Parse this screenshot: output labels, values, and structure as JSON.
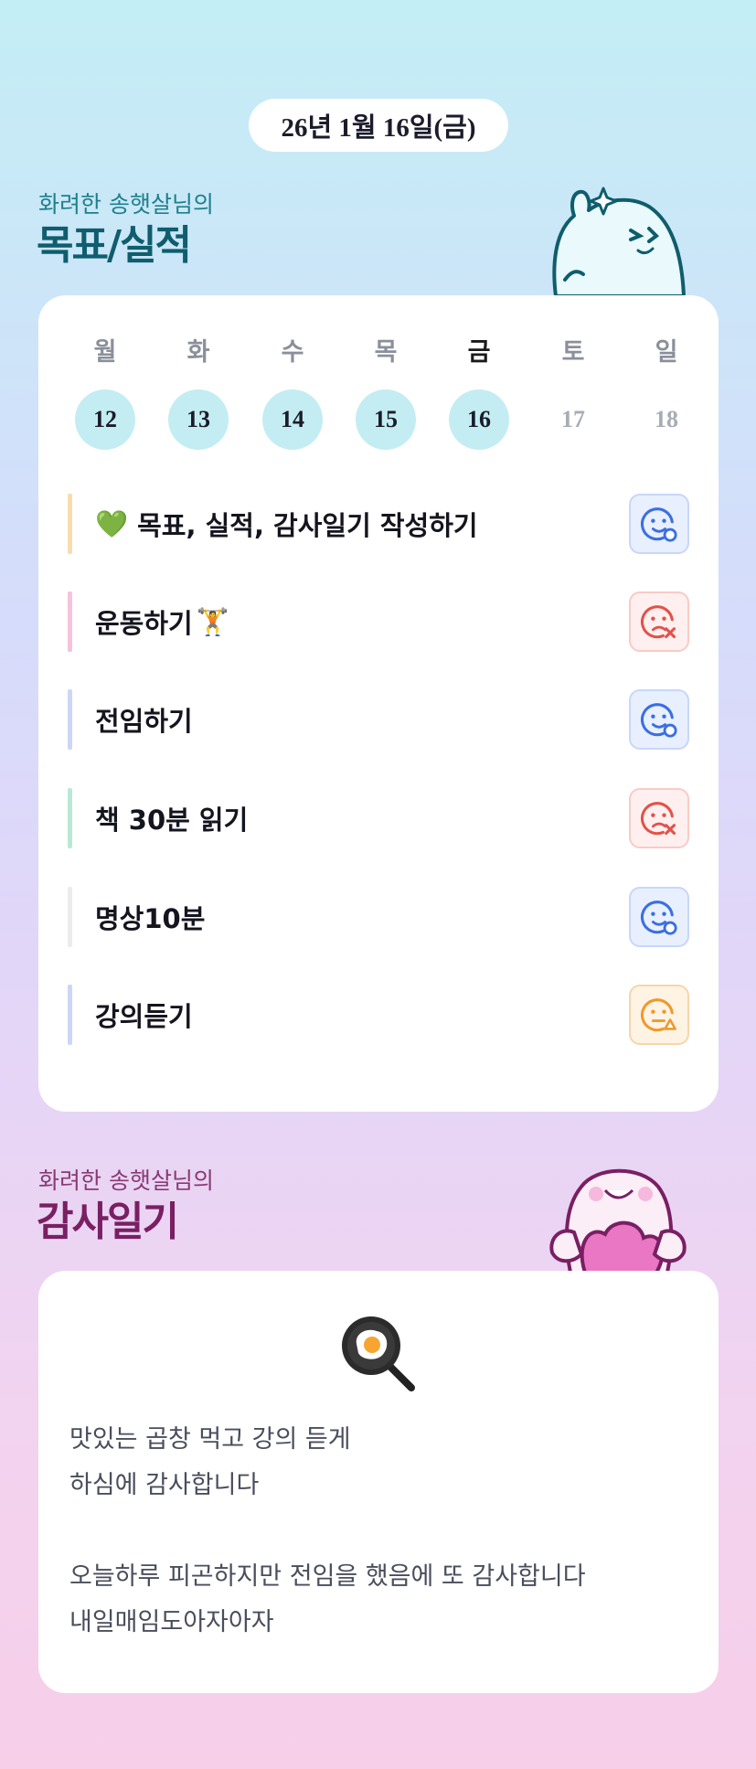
{
  "date": "26년 1월 16일(금)",
  "goals_section": {
    "subtitle": "화려한 송햇살님의",
    "title": "목표/실적"
  },
  "week": {
    "days": [
      {
        "label": "월",
        "num": "12",
        "state": "done"
      },
      {
        "label": "화",
        "num": "13",
        "state": "done"
      },
      {
        "label": "수",
        "num": "14",
        "state": "done"
      },
      {
        "label": "목",
        "num": "15",
        "state": "done"
      },
      {
        "label": "금",
        "num": "16",
        "state": "today"
      },
      {
        "label": "토",
        "num": "17",
        "state": "future"
      },
      {
        "label": "일",
        "num": "18",
        "state": "future"
      }
    ]
  },
  "goals": [
    {
      "emoji": "💚",
      "text": "목표, 실적, 감사일기 작성하기",
      "bar_color": "#f9dcae",
      "status": "success",
      "status_icon": "smile-circle-icon"
    },
    {
      "emoji": "🏋️",
      "text": "운동하기",
      "bar_color": "#f6c2dd",
      "status": "fail",
      "status_icon": "sad-x-icon"
    },
    {
      "emoji": "",
      "text": "전임하기",
      "bar_color": "#cdd6f6",
      "status": "success",
      "status_icon": "smile-circle-icon"
    },
    {
      "emoji": "",
      "text": "책 30분 읽기",
      "bar_color": "#b8ead3",
      "status": "fail",
      "status_icon": "sad-x-icon"
    },
    {
      "emoji": "",
      "text": "명상10분",
      "bar_color": "#ececec",
      "status": "success",
      "status_icon": "smile-circle-icon"
    },
    {
      "emoji": "",
      "text": "강의듣기",
      "bar_color": "#cdd6f6",
      "status": "partial",
      "status_icon": "meh-triangle-icon"
    }
  ],
  "diary_section": {
    "subtitle": "화려한 송햇살님의",
    "title": "감사일기"
  },
  "diary": {
    "icon": "fried-egg-pan-icon",
    "text": "맛있는 곱창 먹고 강의 듣게\n하심에 감사합니다\n\n오늘하루 피곤하지만 전임을 했음에 또 감사합니다\n내일매임도아자아자"
  },
  "colors": {
    "success": "#3b6fe0",
    "fail": "#e2524a",
    "partial": "#ee9a2c",
    "teal": "#0f5d6d",
    "pink": "#7a1f63"
  }
}
